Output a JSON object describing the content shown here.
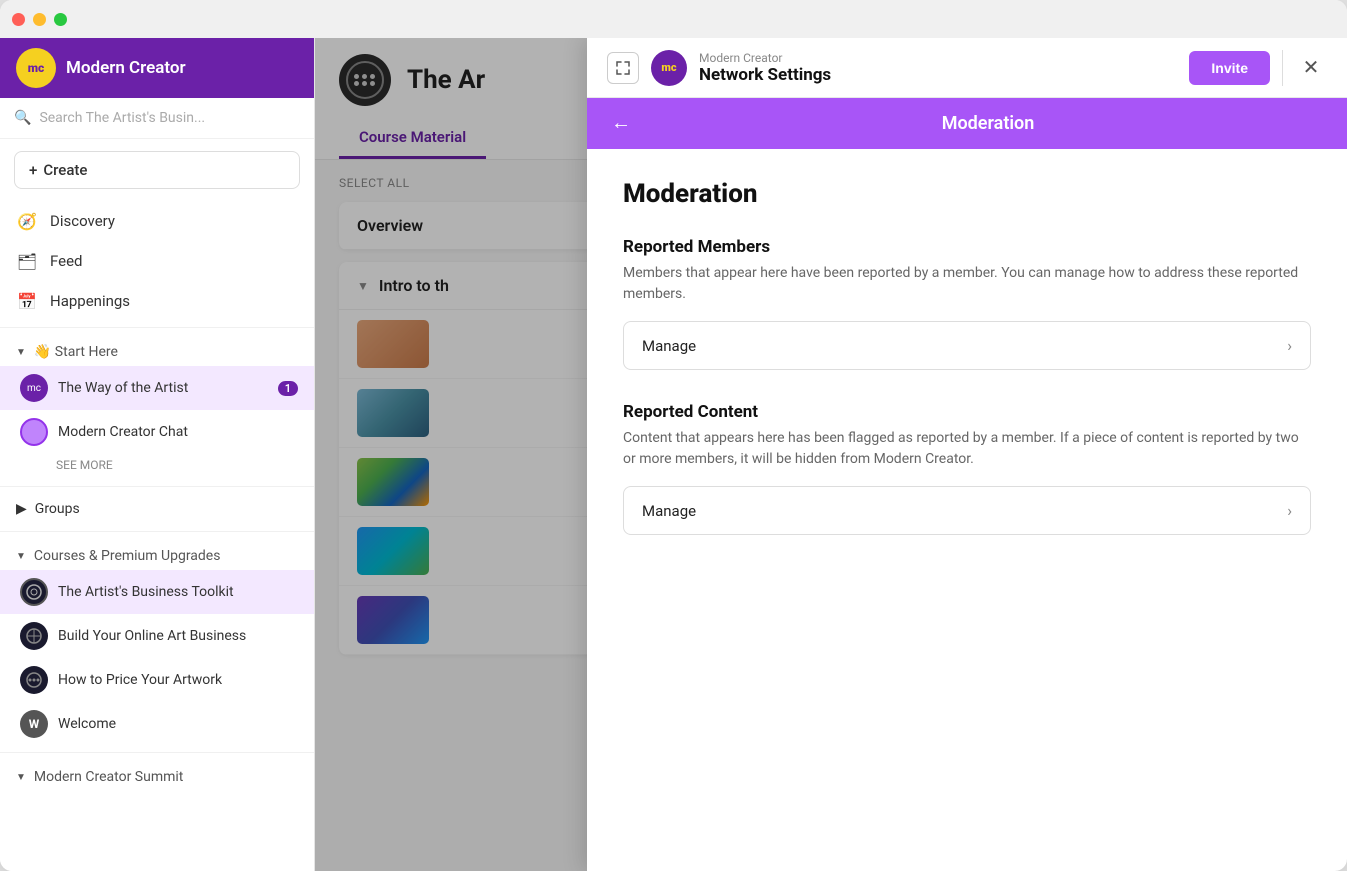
{
  "window": {
    "title": "Modern Creator"
  },
  "sidebar": {
    "brand": "Modern Creator",
    "logo_text": "mc",
    "search_placeholder": "Search The Artist's Busin...",
    "create_label": "Create",
    "nav_items": [
      {
        "id": "discovery",
        "label": "Discovery",
        "icon": "🧭"
      },
      {
        "id": "feed",
        "label": "Feed",
        "icon": "📰"
      },
      {
        "id": "happenings",
        "label": "Happenings",
        "icon": "📅"
      }
    ],
    "section_start_here": {
      "label": "👋 Start Here",
      "items": [
        {
          "id": "way-of-artist",
          "label": "The Way of the Artist",
          "badge": "1",
          "active": true
        },
        {
          "id": "modern-creator-chat",
          "label": "Modern Creator Chat",
          "badge": ""
        }
      ],
      "see_more": "SEE MORE"
    },
    "groups": {
      "label": "Groups"
    },
    "courses_section": {
      "label": "Courses & Premium Upgrades",
      "items": [
        {
          "id": "artists-business-toolkit",
          "label": "The Artist's Business Toolkit",
          "active": true
        },
        {
          "id": "build-online-art-business",
          "label": "Build Your Online Art Business"
        },
        {
          "id": "how-to-price",
          "label": "How to Price Your Artwork"
        },
        {
          "id": "welcome",
          "label": "Welcome",
          "icon": "W"
        }
      ]
    },
    "summit_section": {
      "label": "Modern Creator Summit"
    }
  },
  "main": {
    "course_title": "The Ar",
    "course_title_full": "The Artist's Business Toolkit",
    "tabs": [
      {
        "id": "course-material",
        "label": "Course Material",
        "active": true
      },
      {
        "id": "other",
        "label": ""
      }
    ],
    "select_all": "SELECT ALL",
    "overview_label": "Overview",
    "intro_section_label": "Intro to th"
  },
  "modal": {
    "subtitle": "Modern Creator",
    "title": "Network Settings",
    "invite_label": "Invite",
    "section_header": "Moderation",
    "moderation_title": "Moderation",
    "reported_members": {
      "title": "Reported Members",
      "description": "Members that appear here have been reported by a member. You can manage how to address these reported members.",
      "manage_label": "Manage"
    },
    "reported_content": {
      "title": "Reported Content",
      "description": "Content that appears here has been flagged as reported by a member. If a piece of content is reported by two or more members, it will be hidden from Modern Creator.",
      "manage_label": "Manage"
    }
  }
}
